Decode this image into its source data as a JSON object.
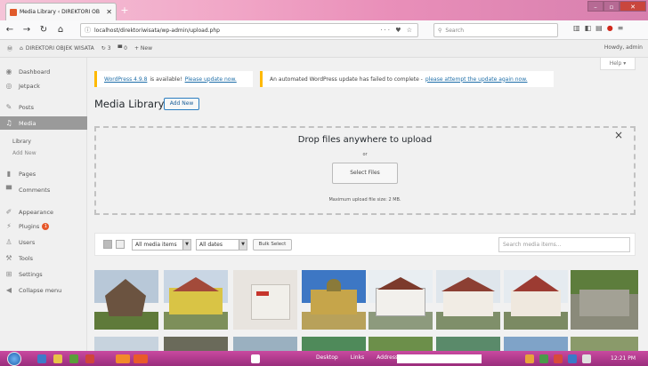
{
  "browser": {
    "tab_title": "Media Library ‹ DIREKTORI OB",
    "url": "localhost/direktoriwisata/wp-admin/upload.php",
    "search_placeholder": "Search",
    "url_tools": "··· ♥ ☆"
  },
  "adminbar": {
    "site_name": "DIREKTORI OBJEK WISATA",
    "updates_count": "3",
    "comments_count": "0",
    "new_label": "+ New",
    "howdy": "Howdy, admin"
  },
  "sidebar": {
    "items": [
      {
        "label": "Dashboard"
      },
      {
        "label": "Jetpack"
      },
      {
        "label": "Posts"
      },
      {
        "label": "Media"
      },
      {
        "label": "Pages"
      },
      {
        "label": "Comments"
      },
      {
        "label": "Appearance"
      },
      {
        "label": "Plugins"
      },
      {
        "label": "Users"
      },
      {
        "label": "Tools"
      },
      {
        "label": "Settings"
      },
      {
        "label": "Collapse menu"
      }
    ],
    "sub_library": "Library",
    "sub_addnew": "Add New",
    "plugins_badge": "1"
  },
  "help_label": "Help ▾",
  "notices": {
    "update_text": "WordPress 4.9.8",
    "update_mid": "is available!",
    "update_link": "Please update now.",
    "failed_text": "An automated WordPress update has failed to complete -",
    "failed_link": "please attempt the update again now."
  },
  "page": {
    "title": "Media Library",
    "add_new": "Add New"
  },
  "uploader": {
    "title": "Drop files anywhere to upload",
    "or": "or",
    "select_files": "Select Files",
    "max_size": "Maximum upload file size: 2 MB.",
    "close": "×"
  },
  "toolbar": {
    "filter_type": "All media items",
    "filter_date": "All dates",
    "bulk_select": "Bulk Select",
    "search_placeholder": "Search media items..."
  },
  "taskbar": {
    "desktop": "Desktop",
    "links": "Links",
    "address": "Address",
    "clock": "12:21 PM"
  },
  "colors": {
    "accent": "#0073aa",
    "title_bar": "#e98fb9",
    "taskbar": "#b03a8c",
    "notice_border": "#ffb900"
  }
}
